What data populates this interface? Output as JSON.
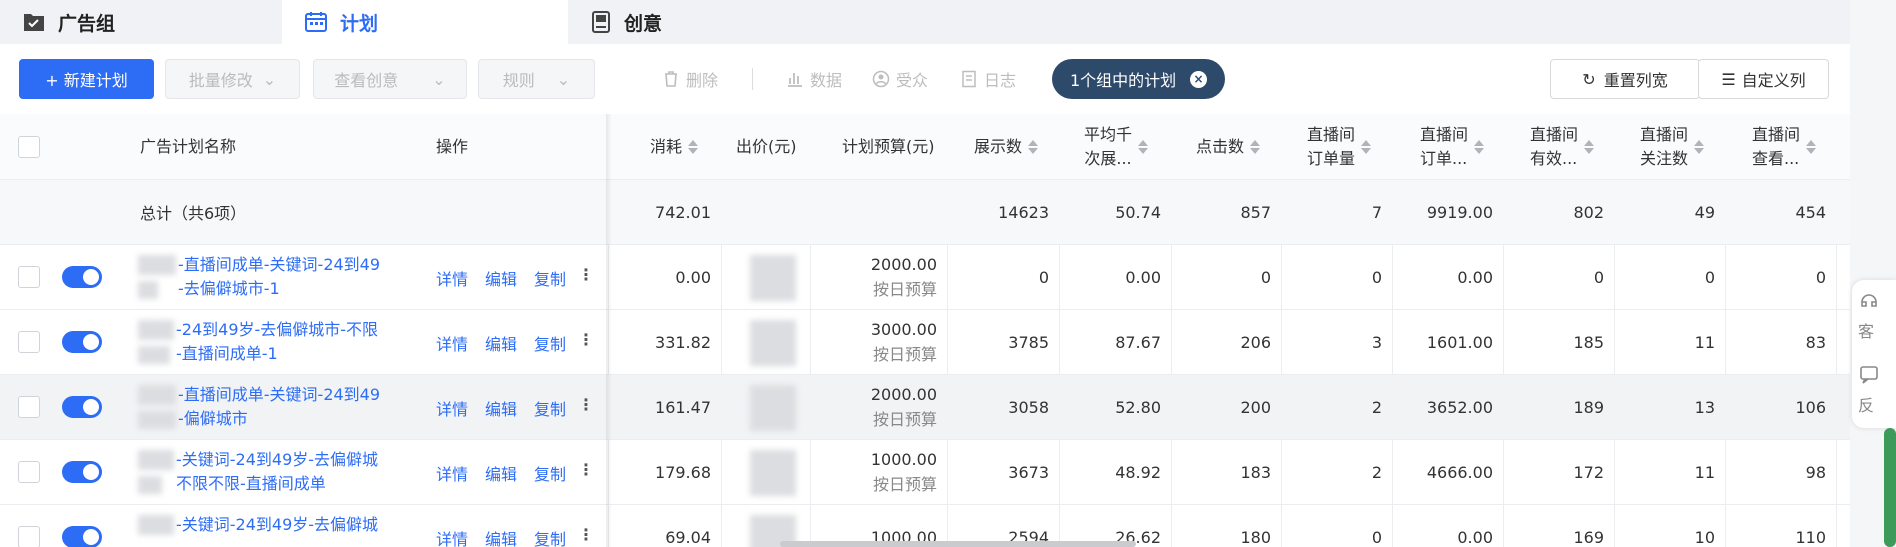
{
  "tabs": [
    {
      "label": "广告组",
      "icon": "folder-check-icon"
    },
    {
      "label": "计划",
      "icon": "calendar-icon",
      "active": true
    },
    {
      "label": "创意",
      "icon": "tablet-icon"
    }
  ],
  "toolbar": {
    "new_plan": "+ 新建计划",
    "batch_edit": "批量修改",
    "view_creative": "查看创意",
    "rules": "规则",
    "delete": "删除",
    "data": "数据",
    "audience": "受众",
    "log": "日志",
    "filter_tag": "1个组中的计划",
    "reset_width": "重置列宽",
    "custom_columns": "自定义列"
  },
  "columns": {
    "name": "广告计划名称",
    "ops": "操作",
    "cost": "消耗",
    "bid": "出价(元)",
    "budget": "计划预算(元)",
    "impressions": "展示数",
    "cpm_1": "平均千",
    "cpm_2": "次展...",
    "clicks": "点击数",
    "live_orders_1": "直播间",
    "live_orders_2": "订单量",
    "live_order_amt_1": "直播间",
    "live_order_amt_2": "订单...",
    "live_valid_1": "直播间",
    "live_valid_2": "有效...",
    "live_follow_1": "直播间",
    "live_follow_2": "关注数",
    "live_view_1": "直播间",
    "live_view_2": "查看..."
  },
  "total": {
    "label": "总计（共6项）",
    "cost": "742.01",
    "impressions": "14623",
    "cpm": "50.74",
    "clicks": "857",
    "live_orders": "7",
    "live_order_amt": "9919.00",
    "live_valid": "802",
    "live_follow": "49",
    "live_view": "454"
  },
  "ops_labels": {
    "detail": "详情",
    "edit": "编辑",
    "copy": "复制",
    "more": "⋮"
  },
  "rows": [
    {
      "name1": "-直播间成单-关键词-24到49",
      "name2": "-去偏僻城市-1",
      "cost": "0.00",
      "budget": "2000.00",
      "budget_type": "按日预算",
      "impressions": "0",
      "cpm": "0.00",
      "clicks": "0",
      "live_orders": "0",
      "live_order_amt": "0.00",
      "live_valid": "0",
      "live_follow": "0",
      "live_view": "0"
    },
    {
      "name1": "-24到49岁-去偏僻城市-不限",
      "name2": "-直播间成单-1",
      "cost": "331.82",
      "budget": "3000.00",
      "budget_type": "按日预算",
      "impressions": "3785",
      "cpm": "87.67",
      "clicks": "206",
      "live_orders": "3",
      "live_order_amt": "1601.00",
      "live_valid": "185",
      "live_follow": "11",
      "live_view": "83"
    },
    {
      "name1": "-直播间成单-关键词-24到49",
      "name2": "-偏僻城市",
      "cost": "161.47",
      "budget": "2000.00",
      "budget_type": "按日预算",
      "impressions": "3058",
      "cpm": "52.80",
      "clicks": "200",
      "live_orders": "2",
      "live_order_amt": "3652.00",
      "live_valid": "189",
      "live_follow": "13",
      "live_view": "106"
    },
    {
      "name1": "-关键词-24到49岁-去偏僻城",
      "name2": "不限不限-直播间成单",
      "cost": "179.68",
      "budget": "1000.00",
      "budget_type": "按日预算",
      "impressions": "3673",
      "cpm": "48.92",
      "clicks": "183",
      "live_orders": "2",
      "live_order_amt": "4666.00",
      "live_valid": "172",
      "live_follow": "11",
      "live_view": "98"
    },
    {
      "name1": "-关键词-24到49岁-去偏僻城",
      "name2": "",
      "cost": "69.04",
      "budget": "1000.00",
      "budget_type": "",
      "impressions": "2594",
      "cpm": "26.62",
      "clicks": "180",
      "live_orders": "0",
      "live_order_amt": "0.00",
      "live_valid": "169",
      "live_follow": "10",
      "live_view": "110"
    }
  ],
  "rail": {
    "service": "客",
    "feedback": "反"
  },
  "colors": {
    "primary": "#2d6df6",
    "filter_pill": "#2e4a6b",
    "scrollbar": "#3c9b58"
  }
}
